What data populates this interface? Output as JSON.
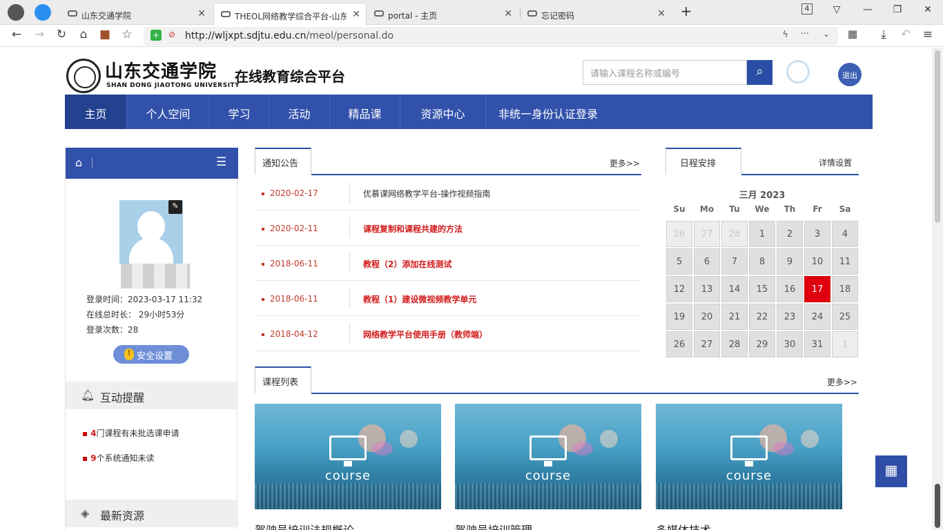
{
  "browser": {
    "tabs": [
      {
        "label": "山东交通学院",
        "active": false
      },
      {
        "label": "THEOL网络教学综合平台-山东",
        "active": true
      },
      {
        "label": "portal - 主页",
        "active": false
      },
      {
        "label": "忘记密码",
        "active": false
      }
    ],
    "tab_count": "4",
    "url_domain": "http://wljxpt.sdjtu.edu.cn",
    "url_path": "/meol/personal.do"
  },
  "header": {
    "school_cn": "山东交通学院",
    "school_en": "SHAN DONG JIAOTONG UNIVERSITY",
    "platform": "在线教育综合平台",
    "search_placeholder": "请输入课程名称或编号",
    "logout_label": "退出"
  },
  "nav": {
    "items": [
      "主页",
      "个人空间",
      "学习",
      "活动",
      "精品课",
      "资源中心",
      "非统一身份认证登录"
    ],
    "active_index": 0
  },
  "profile": {
    "login_time": "登录时间：2023-03-17 11:32",
    "online_total": "在线总时长： 29小时53分",
    "login_count": "登录次数：28",
    "security_label": "安全设置"
  },
  "reminders": {
    "title": "互动提醒",
    "items": [
      {
        "count": "4",
        "text": "门课程有未批选课申请"
      },
      {
        "count": "9",
        "text": "个系统通知未读"
      }
    ]
  },
  "resources": {
    "title": "最新资源"
  },
  "notices": {
    "tab_label": "通知公告",
    "more": "更多>>",
    "items": [
      {
        "date": "2020-02-17",
        "title": "优慕课网络教学平台-操作视频指南",
        "highlight": false
      },
      {
        "date": "2020-02-11",
        "title": "课程复制和课程共建的方法",
        "highlight": true
      },
      {
        "date": "2018-06-11",
        "title": "教程（2）添加在线测试",
        "highlight": true
      },
      {
        "date": "2018-06-11",
        "title": "教程（1）建设微视频教学单元",
        "highlight": true
      },
      {
        "date": "2018-04-12",
        "title": "网络教学平台使用手册（教师端）",
        "highlight": true
      }
    ]
  },
  "schedule": {
    "tab_label": "日程安排",
    "settings": "详情设置",
    "month_label": "三月 2023",
    "weekdays": [
      "Su",
      "Mo",
      "Tu",
      "We",
      "Th",
      "Fr",
      "Sa"
    ],
    "days": [
      [
        "26",
        "27",
        "28",
        "1",
        "2",
        "3",
        "4"
      ],
      [
        "5",
        "6",
        "7",
        "8",
        "9",
        "10",
        "11"
      ],
      [
        "12",
        "13",
        "14",
        "15",
        "16",
        "17",
        "18"
      ],
      [
        "19",
        "20",
        "21",
        "22",
        "23",
        "24",
        "25"
      ],
      [
        "26",
        "27",
        "28",
        "29",
        "30",
        "31",
        "1"
      ]
    ],
    "today": "17"
  },
  "courses": {
    "tab_label": "课程列表",
    "more": "更多>>",
    "image_text": "course",
    "items": [
      {
        "title": "驾驶员培训法规概论"
      },
      {
        "title": "驾驶员培训管理"
      },
      {
        "title": "多媒体技术"
      }
    ]
  },
  "colors": {
    "primary": "#3251ab",
    "accent_red": "#d21b1b",
    "today": "#e1000f"
  }
}
